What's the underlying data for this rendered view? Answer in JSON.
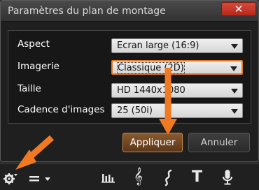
{
  "dialog": {
    "title": "Paramètres du plan de montage",
    "close_glyph": "✕",
    "rows": [
      {
        "label": "Aspect",
        "value": "Ecran large (16:9)"
      },
      {
        "label": "Imagerie",
        "value": "Classique (2D)"
      },
      {
        "label": "Taille",
        "value": "HD 1440x1080"
      },
      {
        "label": "Cadence d'images",
        "value": "25 (50i)"
      }
    ],
    "apply_label": "Appliquer",
    "cancel_label": "Annuler"
  },
  "toolbar": {
    "icons": [
      "gear-icon",
      "track-height-icon",
      "audio-mixer-icon",
      "music-note-icon",
      "sound-effect-icon",
      "text-title-icon",
      "microphone-icon"
    ],
    "glyphs": {
      "music": "𝄞",
      "text": "T"
    }
  },
  "colors": {
    "accent_orange": "#f07a22",
    "close_red": "#c83a2a",
    "apply_brown": "#6e4422"
  }
}
